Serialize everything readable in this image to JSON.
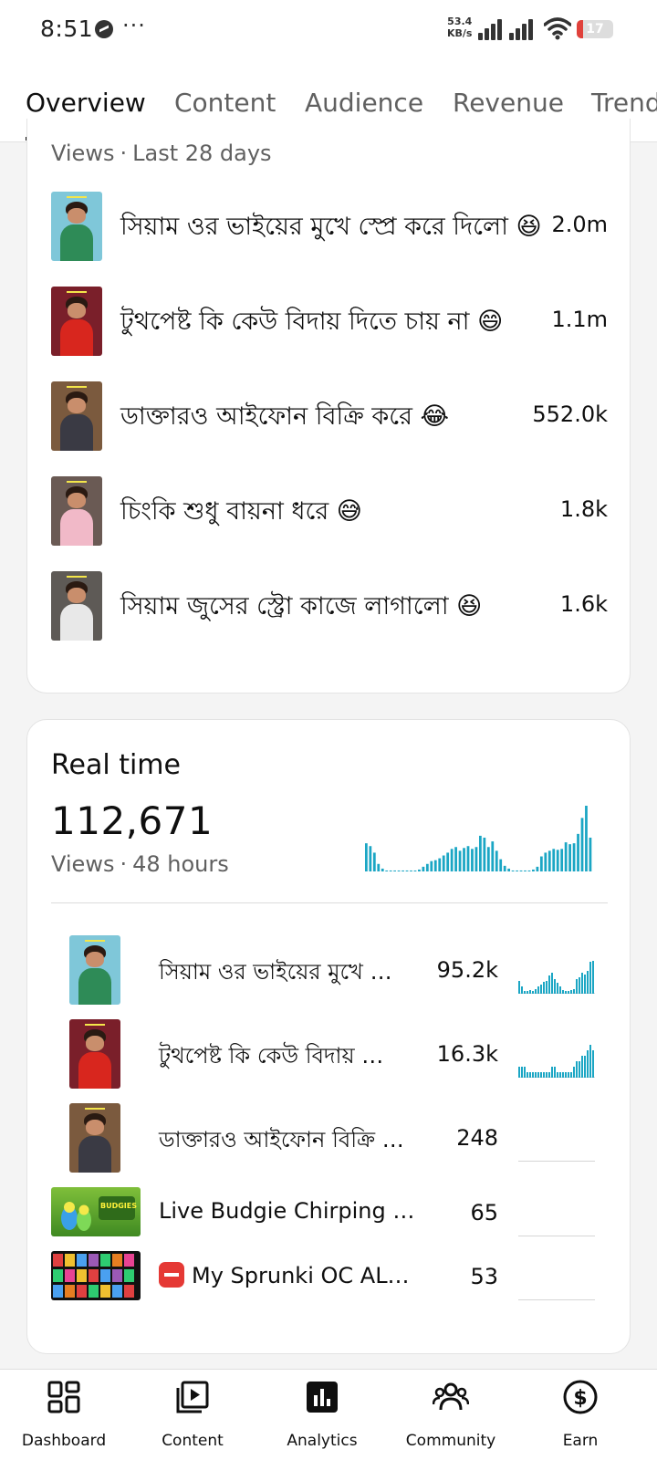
{
  "status_bar": {
    "time": "8:51",
    "dots": "···",
    "net_speed_value": "53.4",
    "net_speed_unit": "KB/s",
    "battery_level": "17",
    "battery_color": "#e0413b"
  },
  "tabs": [
    {
      "label": "Overview",
      "active": true
    },
    {
      "label": "Content",
      "active": false
    },
    {
      "label": "Audience",
      "active": false
    },
    {
      "label": "Revenue",
      "active": false
    },
    {
      "label": "Trends",
      "active": false
    }
  ],
  "top_content": {
    "metric": "Views",
    "range": "Last 28 days",
    "items": [
      {
        "title": "সিয়াম ওর ভাইয়ের মুখে স্প্রে করে দিলো 😆",
        "value": "2.0m"
      },
      {
        "title": "টুথপেষ্ট কি কেউ বিদায় দিতে চায় না 😄",
        "value": "1.1m"
      },
      {
        "title": "ডাক্তারও আইফোন বিক্রি করে 😂",
        "value": "552.0k"
      },
      {
        "title": "চিংকি শুধু বায়না ধরে 😅",
        "value": "1.8k"
      },
      {
        "title": "সিয়াম জুসের স্ট্রো কাজে লাগালো 😆",
        "value": "1.6k"
      }
    ]
  },
  "realtime": {
    "title": "Real time",
    "total": "112,671",
    "metric": "Views",
    "range": "48 hours",
    "accent_color": "#1ba6c4",
    "hourly_views": [
      30,
      27,
      20,
      8,
      3,
      1,
      1,
      1,
      1,
      1,
      1,
      1,
      1,
      2,
      5,
      8,
      11,
      12,
      14,
      17,
      20,
      24,
      26,
      22,
      25,
      27,
      24,
      26,
      38,
      36,
      26,
      32,
      22,
      13,
      6,
      3,
      1,
      1,
      1,
      1,
      1,
      2,
      5,
      16,
      20,
      22,
      24,
      23,
      24,
      31,
      29,
      30,
      40,
      57,
      70,
      36
    ],
    "items": [
      {
        "title": "সিয়াম ওর ভাইয়ের মুখে …",
        "value": "95.2k",
        "trend": [
          14,
          8,
          3,
          3,
          4,
          3,
          5,
          8,
          10,
          13,
          14,
          19,
          22,
          16,
          12,
          8,
          4,
          3,
          3,
          4,
          5,
          16,
          18,
          22,
          20,
          24,
          34,
          35
        ]
      },
      {
        "title": "টুথপেষ্ট কি কেউ বিদায় …",
        "value": "16.3k",
        "trend": [
          2,
          2,
          2,
          1,
          1,
          1,
          1,
          1,
          1,
          1,
          1,
          1,
          2,
          2,
          1,
          1,
          1,
          1,
          1,
          1,
          2,
          3,
          3,
          4,
          4,
          5,
          6,
          5
        ]
      },
      {
        "title": "ডাক্তারও আইফোন বিক্রি …",
        "value": "248",
        "trend": []
      },
      {
        "title": "Live Budgie Chirping …",
        "value": "65",
        "trend": [],
        "thumb_text": "BUDGIES"
      },
      {
        "title": "My Sprunki OC AL…",
        "value": "53",
        "trend": []
      }
    ]
  },
  "bottom_nav": [
    {
      "label": "Dashboard",
      "icon": "dashboard-icon"
    },
    {
      "label": "Content",
      "icon": "content-icon"
    },
    {
      "label": "Analytics",
      "icon": "analytics-icon"
    },
    {
      "label": "Community",
      "icon": "community-icon"
    },
    {
      "label": "Earn",
      "icon": "earn-icon"
    }
  ]
}
